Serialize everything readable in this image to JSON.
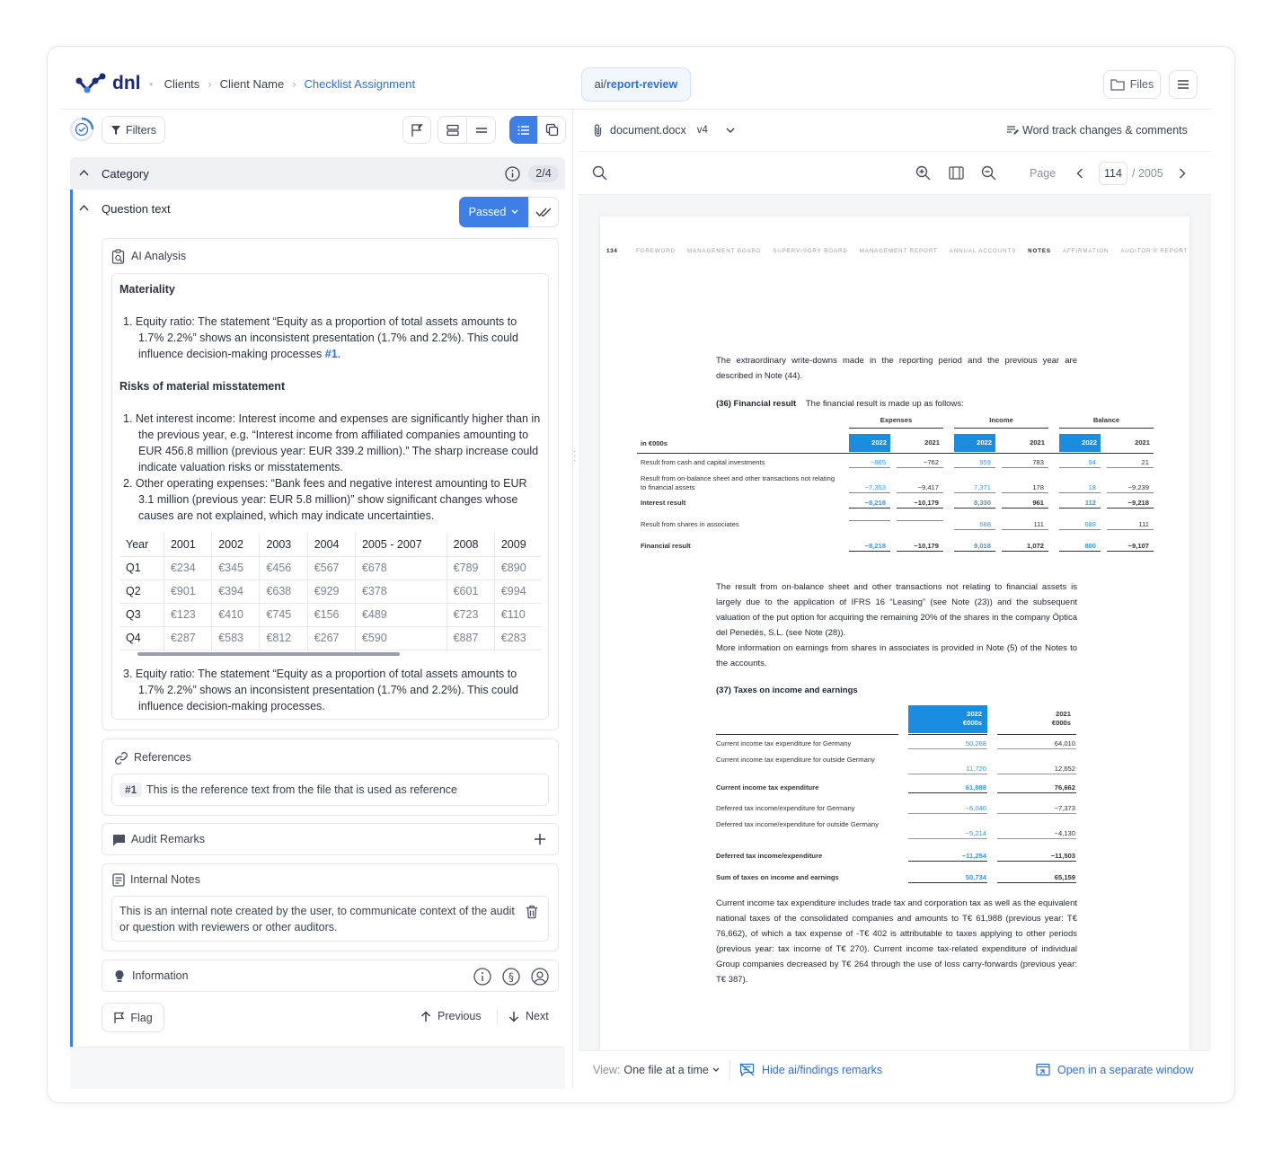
{
  "header": {
    "logo": "dnl",
    "breadcrumb": [
      "Clients",
      "Client Name",
      "Checklist Assignment"
    ],
    "repo_prefix": "ai/",
    "repo_name": "report-review",
    "files_label": "Files"
  },
  "toolbar": {
    "filters_label": "Filters"
  },
  "category": {
    "label": "Category",
    "count": "2/4"
  },
  "question": {
    "label": "Question text",
    "status": "Passed"
  },
  "ai_analysis": {
    "title": "AI Analysis",
    "materiality_heading": "Materiality",
    "materiality_item_prefix": "1.  Equity ratio: The statement “Equity as a proportion of total assets amounts to 1.7% 2.2%” shows an inconsistent presentation (1.7% and 2.2%). This could influence decision-making processes ",
    "materiality_ref": "#1",
    "materiality_item_suffix": ".",
    "risks_heading": "Risks of material misstatement",
    "risk_items": [
      "1.  Net interest income: Interest income and expenses are significantly higher than in the previous year, e.g. “Interest income from affiliated companies amounting to EUR 456.8 million (previous year: EUR 339.2 million).” The sharp increase could indicate valuation risks or misstatements.",
      "2.  Other operating expenses: “Bank fees and negative interest amounting to EUR 3.1 million (previous year: EUR 5.8 million)” show significant changes whose causes are not explained, which may indicate uncertainties."
    ],
    "table": {
      "headers": [
        "Year",
        "2001",
        "2002",
        "2003",
        "2004",
        "2005 - 2007",
        "2008",
        "2009"
      ],
      "rows": [
        [
          "Q1",
          "€234",
          "€345",
          "€456",
          "€567",
          "€678",
          "€789",
          "€890"
        ],
        [
          "Q2",
          "€901",
          "€394",
          "€638",
          "€929",
          "€378",
          "€601",
          "€994"
        ],
        [
          "Q3",
          "€123",
          "€410",
          "€745",
          "€156",
          "€489",
          "€723",
          "€110"
        ],
        [
          "Q4",
          "€287",
          "€583",
          "€812",
          "€267",
          "€590",
          "€887",
          "€283"
        ]
      ]
    },
    "item3": "3. Equity ratio: The statement “Equity as a proportion of total assets amounts to 1.7% 2.2%” shows an inconsistent presentation (1.7% and 2.2%). This could influence decision-making processes."
  },
  "references": {
    "title": "References",
    "tag": "#1",
    "text": "This is the reference text from the file that is used as reference"
  },
  "audit_remarks": {
    "title": "Audit Remarks"
  },
  "internal_notes": {
    "title": "Internal Notes",
    "text": "This is an internal note created by the user, to communicate context of the audit or question with reviewers or other auditors."
  },
  "information": {
    "title": "Information"
  },
  "footer_nav": {
    "flag": "Flag",
    "previous": "Previous",
    "next": "Next"
  },
  "viewer": {
    "file_name": "document.docx",
    "version": "v4",
    "track_changes": "Word track changes & comments",
    "page_label": "Page",
    "page_current": "114",
    "page_total": "/ 2005",
    "view_prefix": "View:",
    "view_value": "One file at a time",
    "hide_remarks": "Hide ai/findings remarks",
    "open_window": "Open in a separate window"
  },
  "document": {
    "page_number": "134",
    "nav": [
      "FOREWORD",
      "MANAGEMENT BOARD",
      "SUPERVISORY BOARD",
      "MANAGEMENT REPORT",
      "ANNUAL ACCOUNTS",
      "NOTES",
      "AFFIRMATION",
      "AUDITOR’S REPORT"
    ],
    "intro": "The extraordinary write-downs made in the reporting period and the previous year are described in Note (44).",
    "fin_heading": "(36) Financial result",
    "fin_sub": "The financial result is made up as follows:",
    "fin_groups": [
      "Expenses",
      "Income",
      "Balance"
    ],
    "fin_unit": "in €000s",
    "fin_years": [
      "2022",
      "2021"
    ],
    "fin_rows": [
      {
        "label": "Result from cash and capital investments",
        "vals": [
          "−865",
          "−762",
          "959",
          "783",
          "94",
          "21"
        ]
      },
      {
        "label": "Result from on-balance sheet and other transactions not relating to financial assets",
        "vals": [
          "−7,353",
          "−9,417",
          "7,371",
          "178",
          "18",
          "−9,239"
        ]
      },
      {
        "label": "Interest result",
        "vals": [
          "−8,218",
          "−10,179",
          "8,330",
          "961",
          "112",
          "−9,218"
        ]
      },
      {
        "label": "Result from shares in associates",
        "vals": [
          "",
          "",
          "688",
          "111",
          "688",
          "111"
        ]
      },
      {
        "label": "Financial result",
        "vals": [
          "−8,218",
          "−10,179",
          "9,018",
          "1,072",
          "800",
          "−9,107"
        ]
      }
    ],
    "para2": "The result from on-balance sheet and other transactions not relating to financial assets is largely due to the application of IFRS 16 “Leasing” (see Note (23)) and the subsequent valuation of the put option for acquiring the remaining 20% of the shares in the company Óptica del Penedés, S.L. (see Note (28)).",
    "para3": "More information on earnings from shares in associates is provided in Note (5) of the Notes to the accounts.",
    "tax_heading": "(37) Taxes on income and earnings",
    "tax_cols": [
      "2022",
      "€000s",
      "2021",
      "€000s"
    ],
    "tax_rows": [
      {
        "label": "Current income tax expenditure for Germany",
        "vals": [
          "50,268",
          "64,010"
        ]
      },
      {
        "label": "Current income tax expenditure for outside Germany",
        "vals": [
          "11,720",
          "12,652"
        ]
      },
      {
        "label": "Current income tax expenditure",
        "vals": [
          "61,988",
          "76,662"
        ]
      },
      {
        "label": "Deferred tax income/expenditure for Germany",
        "vals": [
          "−6,040",
          "−7,373"
        ]
      },
      {
        "label": "Deferred tax income/expenditure for outside Germany",
        "vals": [
          "−5,214",
          "−4,130"
        ]
      },
      {
        "label": "Deferred tax income/expenditure",
        "vals": [
          "−11,254",
          "−11,503"
        ]
      },
      {
        "label": "Sum of taxes on income and earnings",
        "vals": [
          "50,734",
          "65,159"
        ]
      }
    ],
    "para4": "Current income tax expenditure includes trade tax and corporation tax as well as the equivalent national taxes of the consolidated companies and amounts to T€ 61,988 (previous year: T€ 76,662), of which a tax expense of -T€ 402 is attributable to taxes applying to other periods (previous year: tax income of T€ 270). Current income tax-related expenditure of individual Group companies decreased by T€ 264 through the use of loss carry-forwards (previous year: T€ 387)."
  },
  "colors": {
    "accent": "#2f6fdc",
    "primary_button": "#3d7fe6",
    "doc_highlight": "#1a8de0"
  }
}
